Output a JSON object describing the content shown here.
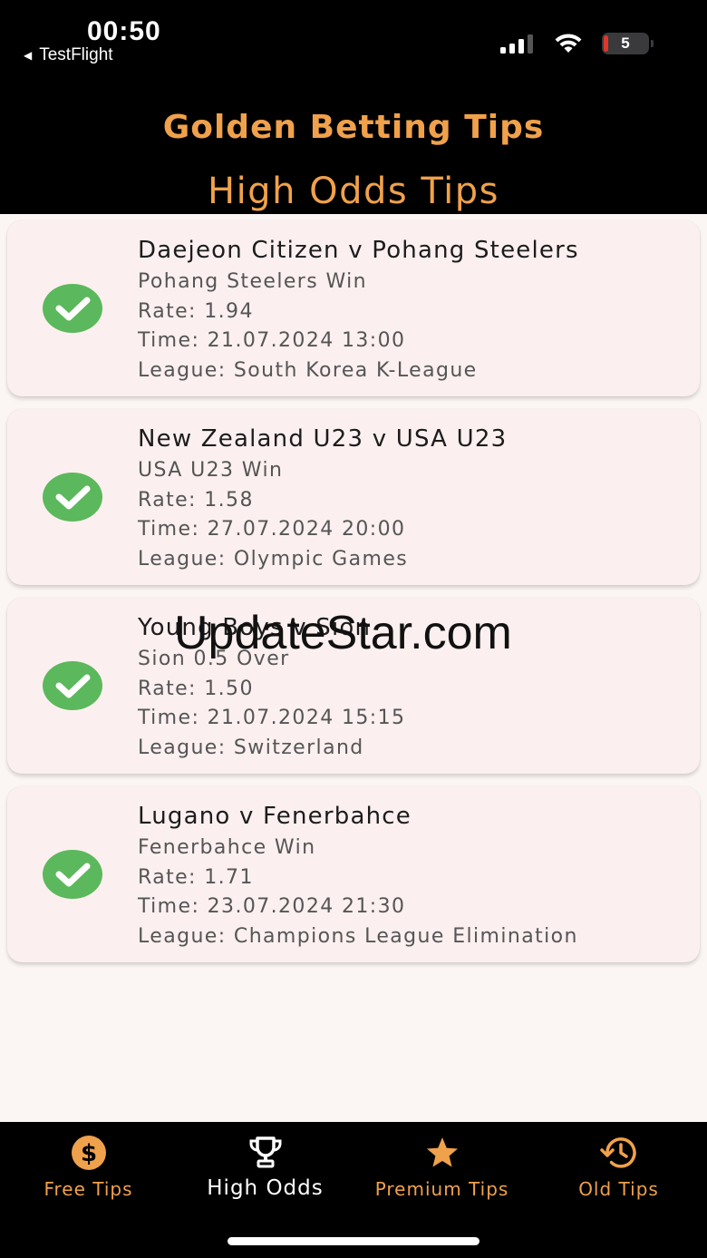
{
  "status_bar": {
    "time": "00:50",
    "back_app": "TestFlight",
    "battery_level": "5"
  },
  "header": {
    "app_title": "Golden Betting Tips",
    "page_title": "High Odds Tips"
  },
  "colors": {
    "accent": "#f0a14b",
    "check_green": "#5cb85c",
    "card_bg": "#fbf0ef",
    "header_bg": "#000000"
  },
  "tips": [
    {
      "match": "Daejeon Citizen v Pohang Steelers",
      "pick": "Pohang Steelers Win",
      "rate": "Rate: 1.94",
      "time": "Time: 21.07.2024 13:00",
      "league": "League: South Korea K-League",
      "status_icon": "check-circle-icon"
    },
    {
      "match": "New Zealand U23 v USA U23",
      "pick": "USA U23 Win",
      "rate": "Rate: 1.58",
      "time": "Time: 27.07.2024 20:00",
      "league": "League: Olympic Games",
      "status_icon": "check-circle-icon"
    },
    {
      "match": "Young Boys v Sion",
      "pick": "Sion 0.5 Over",
      "rate": "Rate: 1.50",
      "time": "Time: 21.07.2024 15:15",
      "league": "League: Switzerland",
      "status_icon": "check-circle-icon"
    },
    {
      "match": "Lugano v Fenerbahce",
      "pick": "Fenerbahce Win",
      "rate": "Rate: 1.71",
      "time": "Time: 23.07.2024 21:30",
      "league": "League: Champions League Elimination",
      "status_icon": "check-circle-icon"
    }
  ],
  "watermark": "UpdateStar.com",
  "tabbar": {
    "items": [
      {
        "label": "Free Tips",
        "icon": "dollar-circle-icon",
        "active": false
      },
      {
        "label": "High Odds",
        "icon": "trophy-icon",
        "active": true
      },
      {
        "label": "Premium Tips",
        "icon": "star-icon",
        "active": false
      },
      {
        "label": "Old Tips",
        "icon": "history-icon",
        "active": false
      }
    ]
  }
}
